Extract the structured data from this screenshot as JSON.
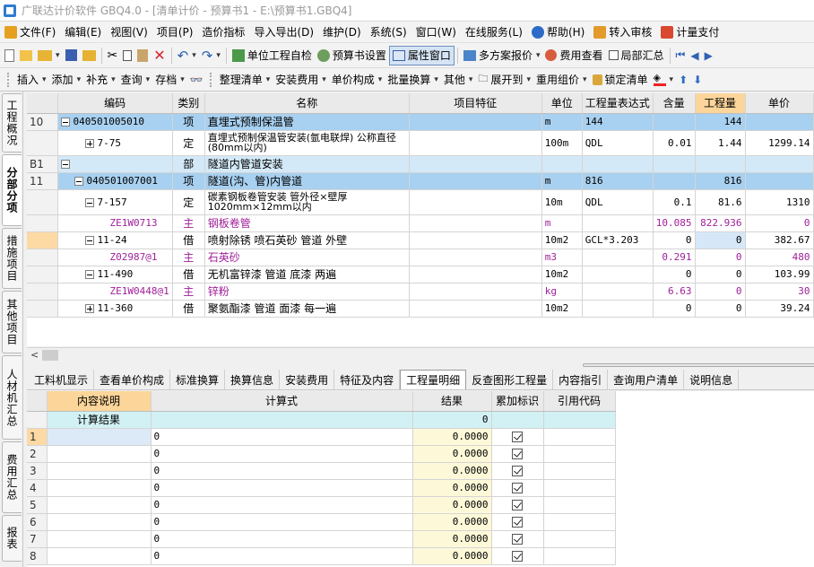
{
  "window": {
    "title": "广联达计价软件 GBQ4.0 - [清单计价 - 预算书1 - E:\\预算书1.GBQ4]"
  },
  "menu": [
    {
      "label": "文件(F)",
      "icon": "file-menu-icon",
      "color": "#e5a022"
    },
    {
      "label": "编辑(E)"
    },
    {
      "label": "视图(V)"
    },
    {
      "label": "项目(P)"
    },
    {
      "label": "造价指标"
    },
    {
      "label": "导入导出(D)"
    },
    {
      "label": "维护(D)"
    },
    {
      "label": "系统(S)"
    },
    {
      "label": "窗口(W)"
    },
    {
      "label": "在线服务(L)"
    },
    {
      "label": "帮助(H)",
      "icon": "help-icon",
      "color": "#2d6bc8"
    },
    {
      "label": "转入审核",
      "icon": "review-icon",
      "color": "#e39a2a"
    },
    {
      "label": "计量支付",
      "icon": "payment-icon",
      "color": "#d9482f"
    }
  ],
  "toolbar1": {
    "self_check": "单位工程自检",
    "budget_settings": "预算书设置",
    "property_window": "属性窗口",
    "multi_quote": "多方案报价",
    "fee_view": "费用查看",
    "partial_summary": "局部汇总"
  },
  "toolbar2": {
    "insert": "插入",
    "add": "添加",
    "supplement": "补充",
    "query": "查询",
    "save": "存档",
    "organize": "整理清单",
    "install_fee": "安装费用",
    "unit_price_comp": "单价构成",
    "batch_convert": "批量换算",
    "other": "其他",
    "expand_to": "展开到",
    "reuse_group": "重用组价",
    "lock_list": "锁定清单"
  },
  "side_tabs": [
    "工程概况",
    "分部分项",
    "措施项目",
    "其他项目",
    "人材机汇总",
    "费用汇总",
    "报表"
  ],
  "upper_grid": {
    "headers": [
      "编码",
      "类别",
      "名称",
      "项目特征",
      "单位",
      "工程量表达式",
      "含量",
      "工程量",
      "单价"
    ],
    "rows": [
      {
        "num": "10",
        "code": "040501005010",
        "type": "项",
        "name": "直埋式预制保温管",
        "feature": "",
        "unit": "m",
        "expr": "144",
        "content": "",
        "qty": "144",
        "price": ""
      },
      {
        "num": "",
        "code": "7-75",
        "type": "定",
        "name": "直埋式预制保温管安装(氩电联焊) 公称直径(80mm以内)",
        "feature": "",
        "unit": "100m",
        "expr": "QDL",
        "content": "0.01",
        "qty": "1.44",
        "price": "1299.14"
      },
      {
        "num": "B1",
        "code": "",
        "type": "部",
        "name": "隧道内管道安装",
        "feature": "",
        "unit": "",
        "expr": "",
        "content": "",
        "qty": "",
        "price": ""
      },
      {
        "num": "11",
        "code": "040501007001",
        "type": "项",
        "name": "隧道(沟、管)内管道",
        "feature": "",
        "unit": "m",
        "expr": "816",
        "content": "",
        "qty": "816",
        "price": ""
      },
      {
        "num": "",
        "code": "7-157",
        "type": "定",
        "name": "碳素钢板卷管安装 管外径×壁厚 1020mm×12mm以内",
        "feature": "",
        "unit": "10m",
        "expr": "QDL",
        "content": "0.1",
        "qty": "81.6",
        "price": "1310"
      },
      {
        "num": "",
        "code": "ZE1W0713",
        "type": "主",
        "name": "钢板卷管",
        "feature": "",
        "unit": "m",
        "expr": "",
        "content": "10.085",
        "qty": "822.936",
        "price": "0"
      },
      {
        "num": "",
        "code": "11-24",
        "type": "借",
        "name": "喷射除锈 喷石英砂 管道 外壁",
        "feature": "",
        "unit": "10m2",
        "expr": "GCL*3.203",
        "content": "0",
        "qty": "0",
        "price": "382.67"
      },
      {
        "num": "",
        "code": "Z02987@1",
        "type": "主",
        "name": "石英砂",
        "feature": "",
        "unit": "m3",
        "expr": "",
        "content": "0.291",
        "qty": "0",
        "price": "480"
      },
      {
        "num": "",
        "code": "11-490",
        "type": "借",
        "name": "无机富锌漆 管道 底漆 两遍",
        "feature": "",
        "unit": "10m2",
        "expr": "",
        "content": "0",
        "qty": "0",
        "price": "103.99"
      },
      {
        "num": "",
        "code": "ZE1W0448@1",
        "type": "主",
        "name": "锌粉",
        "feature": "",
        "unit": "kg",
        "expr": "",
        "content": "6.63",
        "qty": "0",
        "price": "30"
      },
      {
        "num": "",
        "code": "11-360",
        "type": "借",
        "name": "聚氨酯漆 管道 面漆 每一遍",
        "feature": "",
        "unit": "10m2",
        "expr": "",
        "content": "0",
        "qty": "0",
        "price": "39.24"
      }
    ]
  },
  "bottom_tabs": [
    "工料机显示",
    "查看单价构成",
    "标准换算",
    "换算信息",
    "安装费用",
    "特征及内容",
    "工程量明细",
    "反查图形工程量",
    "内容指引",
    "查询用户清单",
    "说明信息"
  ],
  "lower_grid": {
    "headers": [
      "内容说明",
      "计算式",
      "结果",
      "累加标识",
      "引用代码"
    ],
    "summary": {
      "label": "计算结果",
      "result": "0"
    },
    "rows": [
      {
        "num": "1",
        "expr": "0",
        "result": "0.0000"
      },
      {
        "num": "2",
        "expr": "0",
        "result": "0.0000"
      },
      {
        "num": "3",
        "expr": "0",
        "result": "0.0000"
      },
      {
        "num": "4",
        "expr": "0",
        "result": "0.0000"
      },
      {
        "num": "5",
        "expr": "0",
        "result": "0.0000"
      },
      {
        "num": "6",
        "expr": "0",
        "result": "0.0000"
      },
      {
        "num": "7",
        "expr": "0",
        "result": "0.0000"
      },
      {
        "num": "8",
        "expr": "0",
        "result": "0.0000"
      }
    ]
  },
  "colors": {
    "highlight_row": "#a8d0f0",
    "selected_cell": "#c6e2f7",
    "main_material_text": "#a0209a",
    "orange_header": "#fcd59a"
  }
}
